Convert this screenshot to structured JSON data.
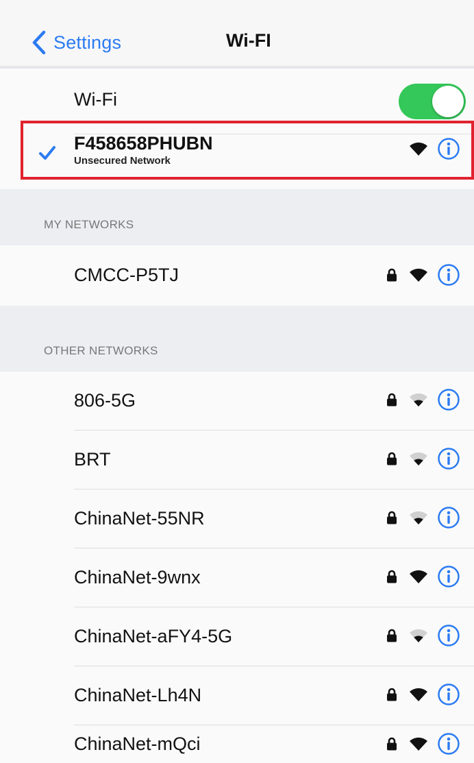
{
  "nav": {
    "back_label": "Settings",
    "title": "Wi-FI"
  },
  "wifi_toggle": {
    "label": "Wi-Fi",
    "on": true
  },
  "connected": {
    "name": "F458658PHUBN",
    "subtitle": "Unsecured Network"
  },
  "my_networks": {
    "header": "MY NETWORKS",
    "items": [
      {
        "name": "CMCC-P5TJ",
        "locked": true
      }
    ]
  },
  "other_networks": {
    "header": "OTHER NETWORKS",
    "items": [
      {
        "name": "806-5G",
        "locked": true
      },
      {
        "name": "BRT",
        "locked": true
      },
      {
        "name": "ChinaNet-55NR",
        "locked": true
      },
      {
        "name": "ChinaNet-9wnx",
        "locked": true
      },
      {
        "name": "ChinaNet-aFY4-5G",
        "locked": true
      },
      {
        "name": "ChinaNet-Lh4N",
        "locked": true
      },
      {
        "name": "ChinaNet-mQci",
        "locked": true
      }
    ]
  },
  "icons": {
    "back": "chevron-left-icon",
    "check": "checkmark-icon",
    "lock": "lock-icon",
    "wifi": "wifi-signal-icon",
    "info": "info-icon"
  },
  "colors": {
    "accent": "#2b7bf2",
    "toggle_on": "#34c759",
    "highlight": "#e0232e"
  }
}
